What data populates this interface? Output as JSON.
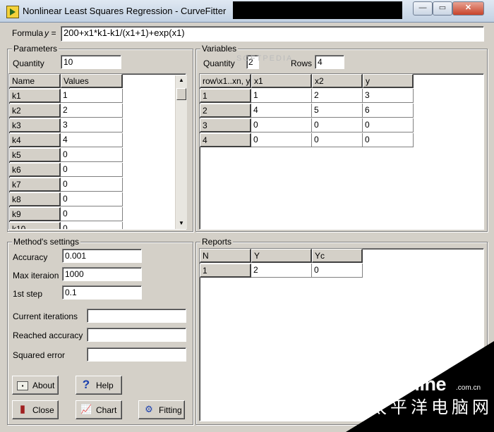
{
  "window": {
    "title": "Nonlinear Least Squares Regression - CurveFitter",
    "minimize_glyph": "—",
    "maximize_glyph": "▭",
    "close_glyph": "✕"
  },
  "formula": {
    "label": "Formula",
    "var_label": "y =",
    "value": "200+x1*k1-k1/(x1+1)+exp(x1)"
  },
  "parameters": {
    "title": "Parameters",
    "quantity_label": "Quantity",
    "quantity_value": "10",
    "columns": [
      "Name",
      "Values"
    ],
    "rows": [
      [
        "k1",
        "1"
      ],
      [
        "k2",
        "2"
      ],
      [
        "k3",
        "3"
      ],
      [
        "k4",
        "4"
      ],
      [
        "k5",
        "0"
      ],
      [
        "k6",
        "0"
      ],
      [
        "k7",
        "0"
      ],
      [
        "k8",
        "0"
      ],
      [
        "k9",
        "0"
      ],
      [
        "k10",
        "0"
      ]
    ]
  },
  "variables": {
    "title": "Variables",
    "quantity_label": "Quantity",
    "quantity_value": "2",
    "rows_label": "Rows",
    "rows_value": "4",
    "columns": [
      "row\\x1..xn, y",
      "x1",
      "x2",
      "y"
    ],
    "rows": [
      [
        "1",
        "1",
        "2",
        "3"
      ],
      [
        "2",
        "4",
        "5",
        "6"
      ],
      [
        "3",
        "0",
        "0",
        "0"
      ],
      [
        "4",
        "0",
        "0",
        "0"
      ]
    ],
    "watermark": "SOFTPEDIA"
  },
  "method": {
    "title": "Method's settings",
    "accuracy_label": "Accuracy",
    "accuracy_value": "0.001",
    "max_iter_label": "Max iteraion",
    "max_iter_value": "1000",
    "first_step_label": "1st step",
    "first_step_value": "0.1",
    "current_iter_label": "Current iterations",
    "current_iter_value": "",
    "reached_acc_label": "Reached accuracy",
    "reached_acc_value": "",
    "squared_err_label": "Squared error",
    "squared_err_value": ""
  },
  "reports": {
    "title": "Reports",
    "columns": [
      "N",
      "Y",
      "Yc"
    ],
    "rows": [
      [
        "1",
        "2",
        "0"
      ]
    ]
  },
  "buttons": {
    "about": "About",
    "help": "Help",
    "close": "Close",
    "chart": "Chart",
    "fitting": "Fitting"
  },
  "icons": {
    "about": "info-card-icon",
    "help": "question-mark-icon",
    "close": "door-exit-icon",
    "chart": "chart-icon",
    "fitting": "fitting-icon"
  },
  "branding": {
    "logo": "PConline",
    "logo_suffix": ".com.cn",
    "logo_cn": "太平洋电脑网"
  }
}
